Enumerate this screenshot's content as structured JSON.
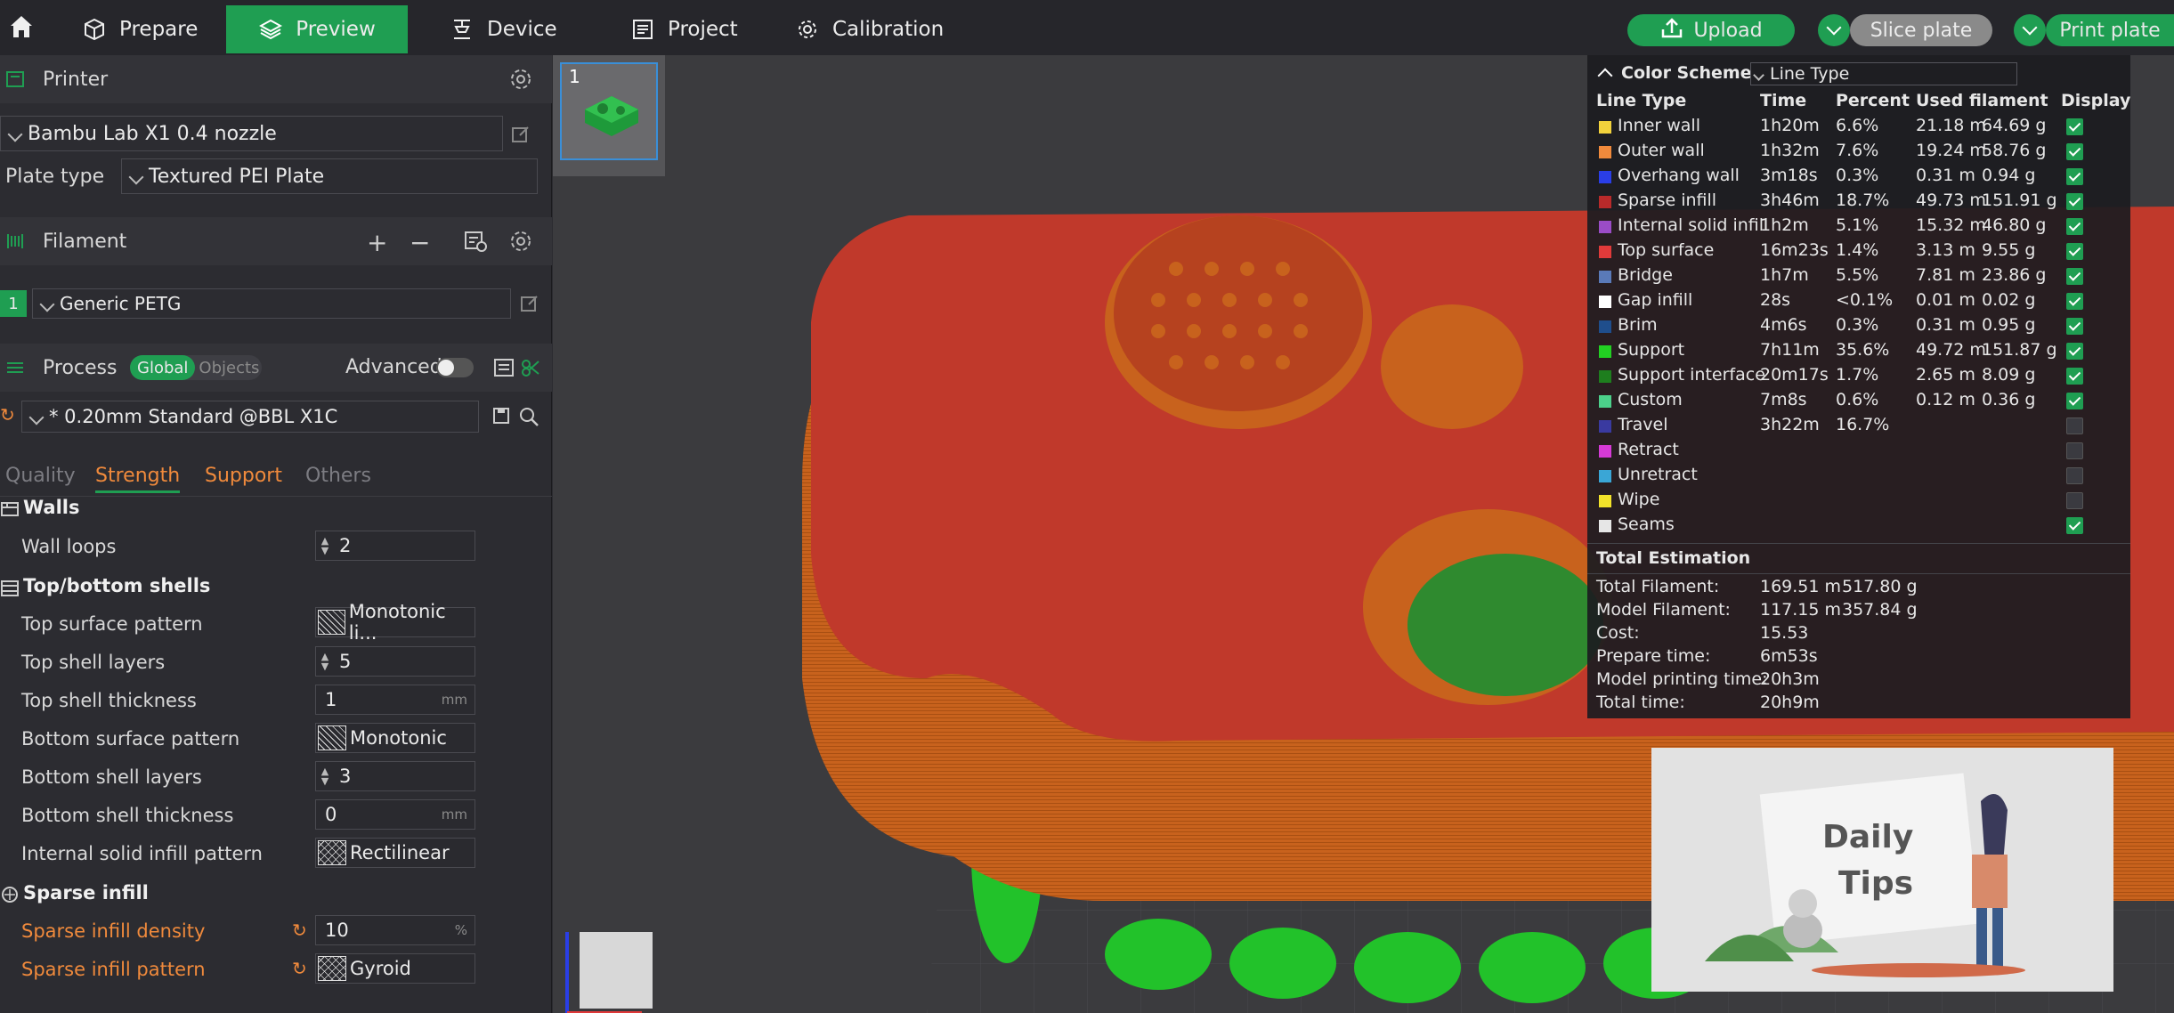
{
  "topbar": {
    "tabs": [
      {
        "label": "Prepare",
        "icon": "cube-icon"
      },
      {
        "label": "Preview",
        "icon": "layers-icon"
      },
      {
        "label": "Device",
        "icon": "device-icon"
      },
      {
        "label": "Project",
        "icon": "document-icon"
      },
      {
        "label": "Calibration",
        "icon": "gear-icon"
      }
    ],
    "upload_label": "Upload",
    "slice_label": "Slice plate",
    "print_label": "Print plate"
  },
  "printer": {
    "section_title": "Printer",
    "name": "Bambu Lab X1 0.4 nozzle",
    "plate_type_label": "Plate type",
    "plate_type": "Textured PEI Plate"
  },
  "filament": {
    "section_title": "Filament",
    "index": "1",
    "name": "Generic PETG"
  },
  "process": {
    "section_title": "Process",
    "toggle_global": "Global",
    "toggle_objects": "Objects",
    "advanced_label": "Advanced",
    "preset": "* 0.20mm Standard @BBL X1C",
    "tabs": [
      "Quality",
      "Strength",
      "Support",
      "Others"
    ],
    "active_tab": "Strength",
    "groups": {
      "walls": {
        "title": "Walls",
        "wall_loops": {
          "label": "Wall loops",
          "value": "2"
        }
      },
      "shells": {
        "title": "Top/bottom shells",
        "top_surface_pattern": {
          "label": "Top surface pattern",
          "value": "Monotonic li..."
        },
        "top_shell_layers": {
          "label": "Top shell layers",
          "value": "5"
        },
        "top_shell_thickness": {
          "label": "Top shell thickness",
          "value": "1",
          "unit": "mm"
        },
        "bottom_surface_pattern": {
          "label": "Bottom surface pattern",
          "value": "Monotonic"
        },
        "bottom_shell_layers": {
          "label": "Bottom shell layers",
          "value": "3"
        },
        "bottom_shell_thickness": {
          "label": "Bottom shell thickness",
          "value": "0",
          "unit": "mm"
        },
        "internal_solid_infill_pattern": {
          "label": "Internal solid infill pattern",
          "value": "Rectilinear"
        }
      },
      "sparse": {
        "title": "Sparse infill",
        "density": {
          "label": "Sparse infill density",
          "value": "10",
          "unit": "%"
        },
        "pattern": {
          "label": "Sparse infill pattern",
          "value": "Gyroid"
        }
      }
    }
  },
  "plate_thumbnail": {
    "index": "1"
  },
  "legend": {
    "title": "Color Scheme",
    "scheme": "Line Type",
    "headers": {
      "line_type": "Line Type",
      "time": "Time",
      "percent": "Percent",
      "used_filament": "Used filament",
      "display": "Display"
    },
    "rows": [
      {
        "name": "Inner wall",
        "color": "#f2d23c",
        "time": "1h20m",
        "percent": "6.6%",
        "length": "21.18 m",
        "weight": "64.69 g",
        "display": true
      },
      {
        "name": "Outer wall",
        "color": "#f08a3c",
        "time": "1h32m",
        "percent": "7.6%",
        "length": "19.24 m",
        "weight": "58.76 g",
        "display": true
      },
      {
        "name": "Overhang wall",
        "color": "#2a3ee6",
        "time": "3m18s",
        "percent": "0.3%",
        "length": "0.31 m",
        "weight": "0.94 g",
        "display": true
      },
      {
        "name": "Sparse infill",
        "color": "#b82a2a",
        "time": "3h46m",
        "percent": "18.7%",
        "length": "49.73 m",
        "weight": "151.91 g",
        "display": true
      },
      {
        "name": "Internal solid infill",
        "color": "#9a4cc6",
        "time": "1h2m",
        "percent": "5.1%",
        "length": "15.32 m",
        "weight": "46.80 g",
        "display": true
      },
      {
        "name": "Top surface",
        "color": "#e03a3a",
        "time": "16m23s",
        "percent": "1.4%",
        "length": "3.13 m",
        "weight": "9.55 g",
        "display": true
      },
      {
        "name": "Bridge",
        "color": "#5a7ab8",
        "time": "1h7m",
        "percent": "5.5%",
        "length": "7.81 m",
        "weight": "23.86 g",
        "display": true
      },
      {
        "name": "Gap infill",
        "color": "#ffffff",
        "time": "28s",
        "percent": "<0.1%",
        "length": "0.01 m",
        "weight": "0.02 g",
        "display": true
      },
      {
        "name": "Brim",
        "color": "#1f4e8c",
        "time": "4m6s",
        "percent": "0.3%",
        "length": "0.31 m",
        "weight": "0.95 g",
        "display": true
      },
      {
        "name": "Support",
        "color": "#22d022",
        "time": "7h11m",
        "percent": "35.6%",
        "length": "49.72 m",
        "weight": "151.87 g",
        "display": true
      },
      {
        "name": "Support interface",
        "color": "#1e7e1e",
        "time": "20m17s",
        "percent": "1.7%",
        "length": "2.65 m",
        "weight": "8.09 g",
        "display": true
      },
      {
        "name": "Custom",
        "color": "#4cd08a",
        "time": "7m8s",
        "percent": "0.6%",
        "length": "0.12 m",
        "weight": "0.36 g",
        "display": true
      },
      {
        "name": "Travel",
        "color": "#3a3aa0",
        "time": "3h22m",
        "percent": "16.7%",
        "length": "",
        "weight": "",
        "display": false
      },
      {
        "name": "Retract",
        "color": "#d63ad6",
        "time": "",
        "percent": "",
        "length": "",
        "weight": "",
        "display": false
      },
      {
        "name": "Unretract",
        "color": "#3aa6d6",
        "time": "",
        "percent": "",
        "length": "",
        "weight": "",
        "display": false
      },
      {
        "name": "Wipe",
        "color": "#f2e22a",
        "time": "",
        "percent": "",
        "length": "",
        "weight": "",
        "display": false
      },
      {
        "name": "Seams",
        "color": "#e6e6e6",
        "time": "",
        "percent": "",
        "length": "",
        "weight": "",
        "display": true
      }
    ],
    "total": {
      "title": "Total Estimation",
      "items": [
        {
          "label": "Total Filament:",
          "value": "169.51 m",
          "value2": "517.80 g"
        },
        {
          "label": "Model Filament:",
          "value": "117.15 m",
          "value2": "357.84 g"
        },
        {
          "label": "Cost:",
          "value": "15.53",
          "value2": ""
        },
        {
          "label": "Prepare time:",
          "value": "6m53s",
          "value2": ""
        },
        {
          "label": "Model printing time:",
          "value": "20h3m",
          "value2": ""
        },
        {
          "label": "Total time:",
          "value": "20h9m",
          "value2": ""
        }
      ]
    }
  },
  "tips": {
    "line1": "Daily",
    "line2": "Tips"
  },
  "colors": {
    "accent": "#1f9e52",
    "active_tab": "#f08a3c",
    "model_top": "#c0392b",
    "model_wall": "#c8631c",
    "support": "#22c22a"
  }
}
